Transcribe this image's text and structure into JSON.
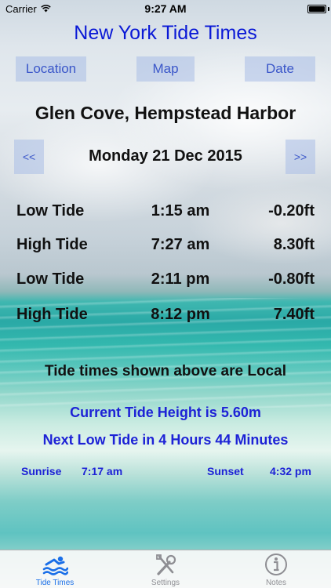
{
  "status_bar": {
    "carrier": "Carrier",
    "time": "9:27 AM"
  },
  "app": {
    "title": "New York Tide Times"
  },
  "toolbar": {
    "location": "Location",
    "map": "Map",
    "date": "Date"
  },
  "station": "Glen Cove, Hempstead Harbor",
  "date_nav": {
    "prev": "<<",
    "date": "Monday 21 Dec 2015",
    "next": ">>"
  },
  "tides": [
    {
      "type": "Low Tide",
      "time": "1:15 am",
      "height": "-0.20ft"
    },
    {
      "type": "High Tide",
      "time": "7:27 am",
      "height": "8.30ft"
    },
    {
      "type": "Low Tide",
      "time": "2:11 pm",
      "height": "-0.80ft"
    },
    {
      "type": "High Tide",
      "time": "8:12 pm",
      "height": "7.40ft"
    }
  ],
  "local_note": "Tide times shown above are Local",
  "current_height": "Current Tide Height is 5.60m",
  "next_low": "Next Low Tide in 4 Hours 44 Minutes",
  "sun": {
    "sunrise_label": "Sunrise",
    "sunrise_time": "7:17 am",
    "sunset_label": "Sunset",
    "sunset_time": "4:32 pm"
  },
  "tabs": [
    {
      "label": "Tide Times",
      "icon": "swimmer-icon",
      "active": true
    },
    {
      "label": "Settings",
      "icon": "tools-icon",
      "active": false
    },
    {
      "label": "Notes",
      "icon": "info-icon",
      "active": false
    }
  ],
  "colors": {
    "title": "#0a19d6",
    "info_text": "#1d22d6",
    "button_text": "#3a56c9",
    "tab_active": "#1a6fe8",
    "tab_inactive": "#8e8e93"
  }
}
